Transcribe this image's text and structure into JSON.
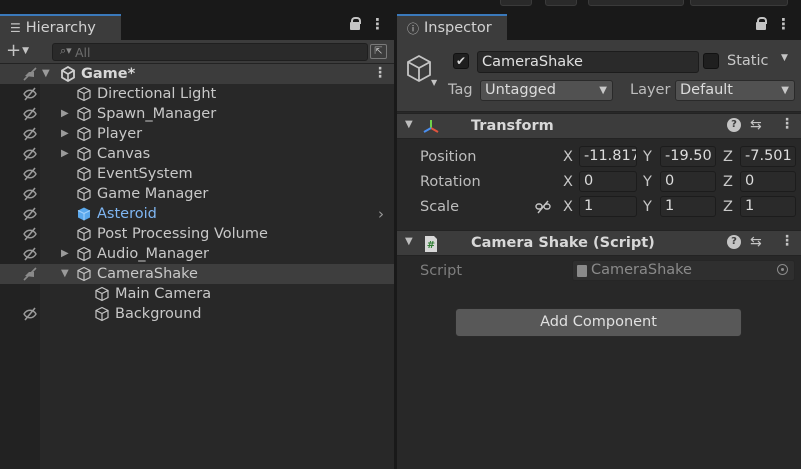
{
  "hierarchy": {
    "tab_label": "Hierarchy",
    "add_label": "+",
    "search_placeholder": "All",
    "scene": {
      "name": "Game*"
    },
    "items": [
      {
        "name": "Directional Light",
        "hidden": true,
        "expandable": false,
        "prefab": false,
        "indent": 0
      },
      {
        "name": "Spawn_Manager",
        "hidden": true,
        "expandable": true,
        "prefab": false,
        "indent": 0
      },
      {
        "name": "Player",
        "hidden": true,
        "expandable": true,
        "prefab": false,
        "indent": 0
      },
      {
        "name": "Canvas",
        "hidden": true,
        "expandable": true,
        "prefab": false,
        "indent": 0
      },
      {
        "name": "EventSystem",
        "hidden": true,
        "expandable": false,
        "prefab": false,
        "indent": 0
      },
      {
        "name": "Game Manager",
        "hidden": true,
        "expandable": false,
        "prefab": false,
        "indent": 0
      },
      {
        "name": "Asteroid",
        "hidden": true,
        "expandable": false,
        "prefab": true,
        "indent": 0
      },
      {
        "name": "Post Processing Volume",
        "hidden": true,
        "expandable": false,
        "prefab": false,
        "indent": 0
      },
      {
        "name": "Audio_Manager",
        "hidden": true,
        "expandable": true,
        "prefab": false,
        "indent": 0
      },
      {
        "name": "CameraShake",
        "hidden": true,
        "expandable": true,
        "expanded": true,
        "selected": true,
        "prefab": false,
        "indent": 0
      },
      {
        "name": "Main Camera",
        "hidden": false,
        "expandable": false,
        "prefab": false,
        "indent": 1
      },
      {
        "name": "Background",
        "hidden": true,
        "expandable": false,
        "prefab": false,
        "indent": 1
      }
    ]
  },
  "inspector": {
    "tab_label": "Inspector",
    "object": {
      "name": "CameraShake",
      "active": true,
      "static_label": "Static",
      "tag_label": "Tag",
      "tag_value": "Untagged",
      "layer_label": "Layer",
      "layer_value": "Default"
    },
    "transform": {
      "title": "Transform",
      "position_label": "Position",
      "rotation_label": "Rotation",
      "scale_label": "Scale",
      "axis_x": "X",
      "axis_y": "Y",
      "axis_z": "Z",
      "position": {
        "x": "-11.817",
        "y": "-19.50",
        "z": "-7.501"
      },
      "rotation": {
        "x": "0",
        "y": "0",
        "z": "0"
      },
      "scale": {
        "x": "1",
        "y": "1",
        "z": "1"
      }
    },
    "script_component": {
      "title": "Camera Shake (Script)",
      "script_label": "Script",
      "script_value": "CameraShake"
    },
    "add_component_label": "Add Component"
  },
  "colors": {
    "accent": "#3a79bb",
    "prefab_text": "#7fb6f2",
    "panel_bg": "#282828",
    "header_bg": "#3c3c3c"
  }
}
